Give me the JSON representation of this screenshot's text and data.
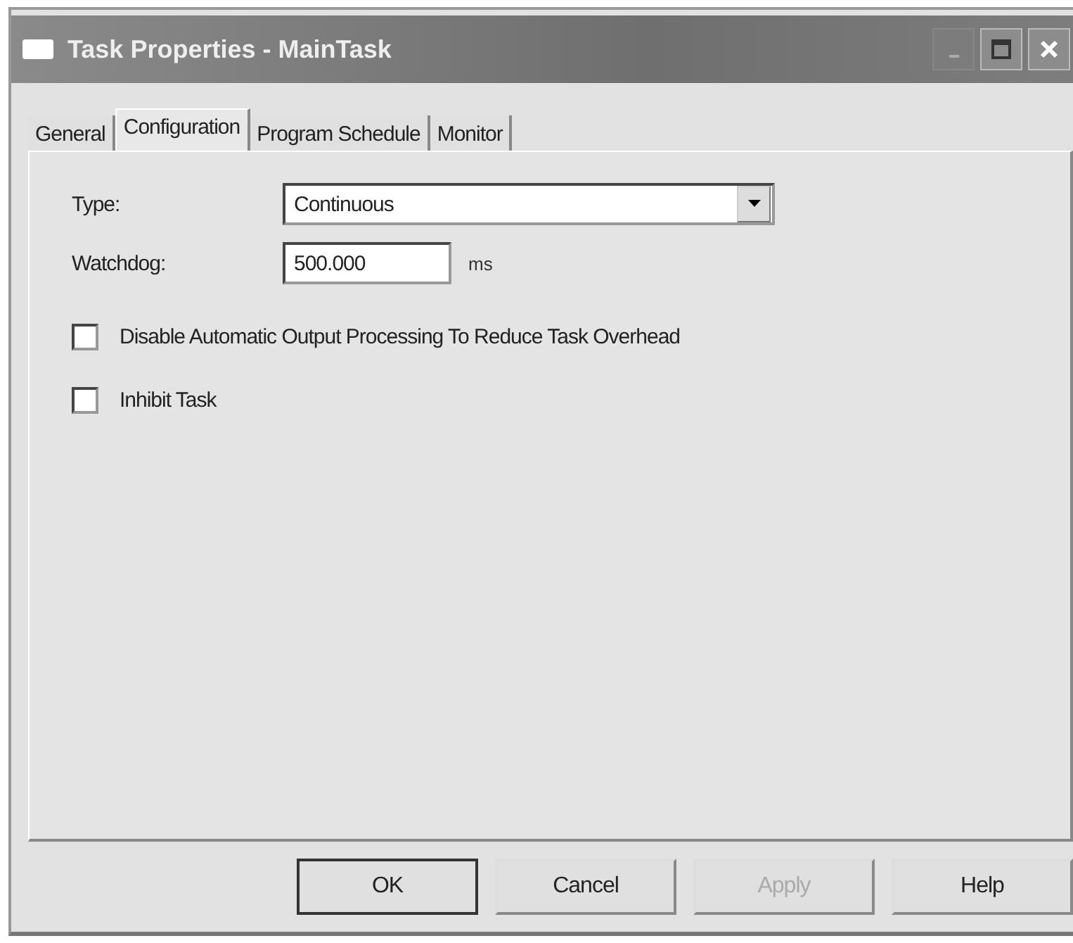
{
  "window": {
    "title": "Task Properties - MainTask"
  },
  "tabs": [
    {
      "label": "General",
      "selected": false
    },
    {
      "label": "Configuration",
      "selected": true
    },
    {
      "label": "Program Schedule",
      "selected": false
    },
    {
      "label": "Monitor",
      "selected": false
    }
  ],
  "type": {
    "label": "Type:",
    "value": "Continuous"
  },
  "watchdog": {
    "label": "Watchdog:",
    "value": "500.000",
    "unit": "ms"
  },
  "options": [
    {
      "label": "Disable Automatic Output Processing To Reduce Task Overhead",
      "checked": false
    },
    {
      "label": "Inhibit Task",
      "checked": false
    }
  ],
  "buttons": [
    {
      "label": "OK",
      "default": true,
      "disabled": false
    },
    {
      "label": "Cancel",
      "default": false,
      "disabled": false
    },
    {
      "label": "Apply",
      "default": false,
      "disabled": true
    },
    {
      "label": "Help",
      "default": false,
      "disabled": false
    }
  ]
}
